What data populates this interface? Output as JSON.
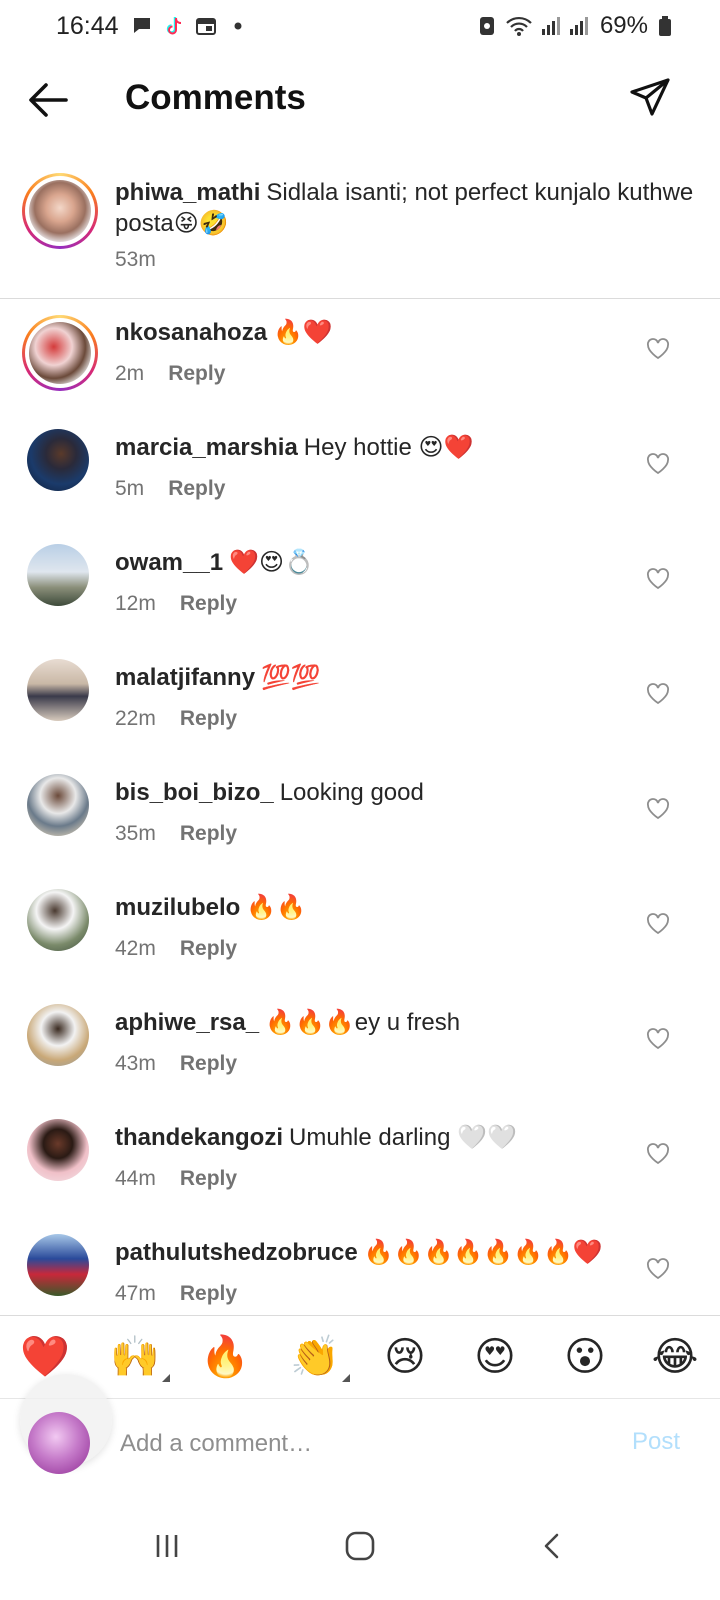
{
  "status_bar": {
    "time": "16:44",
    "battery": "69%",
    "left_icons": [
      "message-icon",
      "tiktok-icon",
      "calendar-icon",
      "dot-icon"
    ],
    "right_icons": [
      "vpn-icon",
      "wifi-icon",
      "signal-icon",
      "signal-icon-2",
      "battery-icon"
    ]
  },
  "header": {
    "title": "Comments"
  },
  "caption": {
    "username": "phiwa_mathi",
    "text": "Sidlala isanti; not perfect kunjalo kuthwe posta😝🤣",
    "time": "53m"
  },
  "comments": [
    {
      "username": "nkosanahoza",
      "text": "🔥❤️",
      "time": "2m",
      "reply": "Reply"
    },
    {
      "username": "marcia_marshia",
      "text": "Hey hottie 😍❤️",
      "time": "5m",
      "reply": "Reply"
    },
    {
      "username": "owam__1",
      "text": "❤️😍💍",
      "time": "12m",
      "reply": "Reply"
    },
    {
      "username": "malatjifanny",
      "text": "💯💯",
      "time": "22m",
      "reply": "Reply"
    },
    {
      "username": "bis_boi_bizo_",
      "text": "Looking good",
      "time": "35m",
      "reply": "Reply"
    },
    {
      "username": "muzilubelo",
      "text": "🔥🔥",
      "time": "42m",
      "reply": "Reply"
    },
    {
      "username": "aphiwe_rsa_",
      "text": "🔥🔥🔥ey u fresh",
      "time": "43m",
      "reply": "Reply"
    },
    {
      "username": "thandekangozi",
      "text": "Umuhle darling 🤍🤍",
      "time": "44m",
      "reply": "Reply"
    },
    {
      "username": "pathulutshedzobruce",
      "text": "🔥🔥🔥🔥🔥🔥🔥❤️",
      "time": "47m",
      "reply": "Reply"
    }
  ],
  "reactions": [
    "❤️",
    "🙌",
    "🔥",
    "👏",
    "😢",
    "😍",
    "😮",
    "😂"
  ],
  "input": {
    "placeholder": "Add a comment…",
    "post_label": "Post"
  },
  "colors": {
    "text": "#262626",
    "muted": "#737373",
    "post_disabled": "#b2dffc",
    "divider": "#dbdbdb"
  }
}
